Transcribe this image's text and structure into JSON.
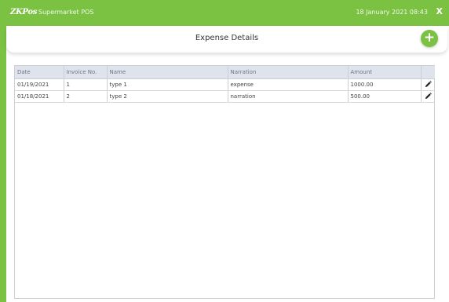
{
  "topbar": {
    "logo": "ZKPos",
    "app_name": "Supermarket POS",
    "datetime": "18 January 2021 08:43",
    "close_label": "X"
  },
  "header": {
    "title": "Expense Details",
    "add_label": "+"
  },
  "table": {
    "columns": [
      "Date",
      "Invoice No.",
      "Name",
      "Narration",
      "Amount",
      ""
    ],
    "rows": [
      {
        "date": "01/19/2021",
        "invoice": "1",
        "name": "type 1",
        "narration": "expense",
        "amount": "1000.00"
      },
      {
        "date": "01/18/2021",
        "invoice": "2",
        "name": "type 2",
        "narration": "narration",
        "amount": "500.00"
      }
    ]
  },
  "colors": {
    "brand_green": "#7cc242",
    "header_row": "#dfe4ec"
  },
  "icons": {
    "edit": "pencil-icon",
    "add": "plus-icon",
    "close": "close-icon"
  }
}
